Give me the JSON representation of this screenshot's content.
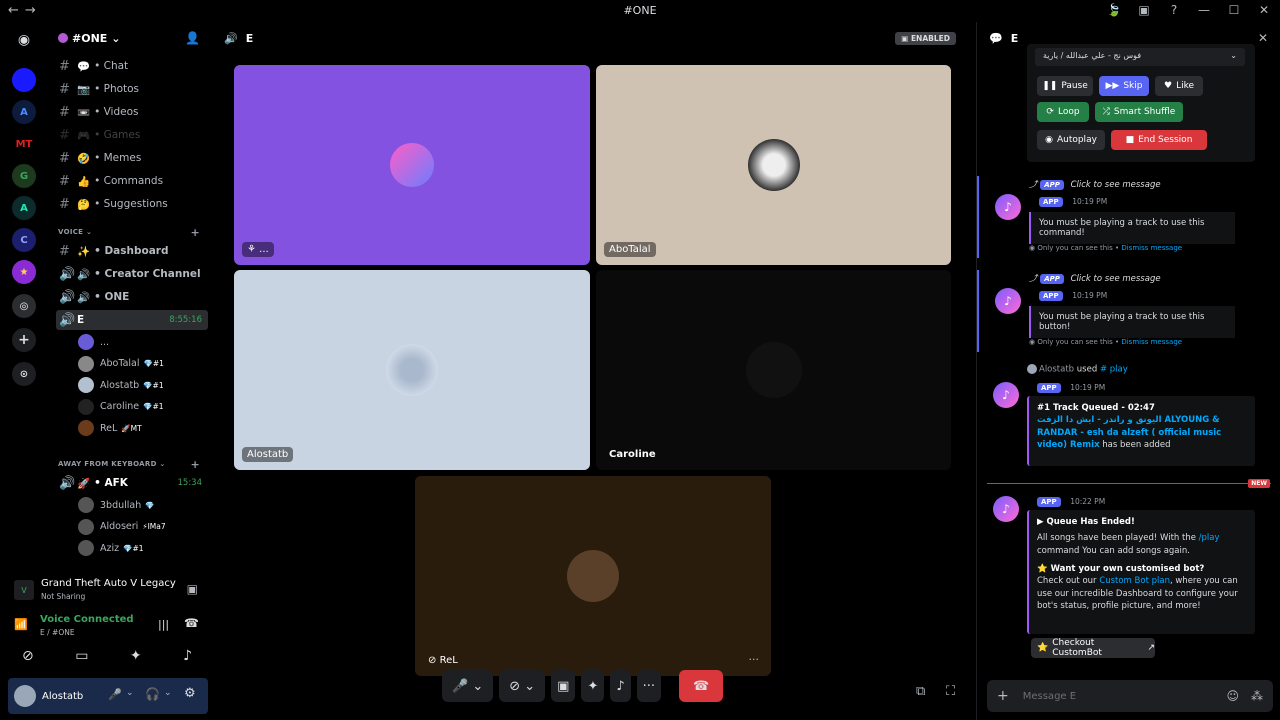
{
  "window": {
    "title": "#ONE"
  },
  "server": {
    "name": "#ONE"
  },
  "text_channels": [
    {
      "label": "• Chat",
      "emoji": "💬"
    },
    {
      "label": "• Photos",
      "emoji": "📷"
    },
    {
      "label": "• Videos",
      "emoji": "📼"
    },
    {
      "label": "• Games",
      "emoji": "🎮"
    },
    {
      "label": "• Memes",
      "emoji": "🤣"
    },
    {
      "label": "• Commands",
      "emoji": "👍"
    },
    {
      "label": "• Suggestions",
      "emoji": "🤔"
    }
  ],
  "voice_category": "VOICE",
  "voice_channels": [
    {
      "label": "• Dashboard",
      "emoji": "✨"
    },
    {
      "label": "• Creator Channel",
      "emoji": "🔊"
    },
    {
      "label": "• ONE",
      "emoji": "🔊"
    },
    {
      "label": "E",
      "timer": "8:55:16"
    }
  ],
  "voice_users": [
    {
      "name": "...",
      "tag": ""
    },
    {
      "name": "AboTalal",
      "tag": "💎#1"
    },
    {
      "name": "Alostatb",
      "tag": "💎#1"
    },
    {
      "name": "Caroline",
      "tag": "💎#1"
    },
    {
      "name": "ReL",
      "tag": "🚀MT"
    }
  ],
  "afk_category": "AWAY FROM KEYBOARD",
  "afk_channel": {
    "label": "• AFK",
    "timer": "15:34"
  },
  "afk_users": [
    {
      "name": "3bdullah",
      "tag": "💎"
    },
    {
      "name": "Aldoseri",
      "tag": "⚡IMa7"
    },
    {
      "name": "Aziz",
      "tag": "💎#1"
    }
  ],
  "activity": {
    "game": "Grand Theft Auto V Legacy",
    "status": "Not Sharing"
  },
  "voice_status": {
    "label": "Voice Connected",
    "channel": "E / #ONE"
  },
  "user": {
    "name": "Alostatb"
  },
  "call": {
    "channel": "E",
    "badge": "ENABLED"
  },
  "tiles": [
    {
      "label": "...",
      "bg": "#8452e0"
    },
    {
      "label": "AboTalal",
      "bg": "#cfc2b2"
    },
    {
      "label": "Alostatb",
      "bg": "#c9d4e2"
    },
    {
      "label": "Caroline",
      "bg": "#0a0a0a"
    },
    {
      "label": "ReL",
      "bg": "#2a1c0d"
    }
  ],
  "chat": {
    "channel": "E",
    "now_playing": "فوس نج - علي عبدالله / يارية",
    "buttons": {
      "pause": "Pause",
      "skip": "Skip",
      "like": "Like",
      "loop": "Loop",
      "smart_shuffle": "Smart Shuffle",
      "autoplay": "Autoplay",
      "end_session": "End Session"
    },
    "app_badge": "APP",
    "click_to_see": "Click to see message",
    "time1": "10:19 PM",
    "msg1": "You must be playing a track to use this command!",
    "only_you": "Only you can see this •",
    "dismiss": "Dismiss message",
    "msg2": "You must be playing a track to use this button!",
    "used_user": "Alostatb",
    "used_text": "used",
    "used_cmd": "# play",
    "queued_title": "#1 Track Queued - 02:47",
    "queued_track": "اليونق و راندر - ايش دا الزفت ALYOUNG & RANDAR - esh da alzeft ( official music video) Remix",
    "queued_suffix": "has been added",
    "new_badge": "NEW",
    "time2": "10:22 PM",
    "ended_title": "Queue Has Ended!",
    "ended_p1": "All songs have been played! With the",
    "ended_cmd": "/play",
    "ended_p2": "command You can add songs again.",
    "custom_title": "Want your own customised bot?",
    "custom_p1": "Check out our",
    "custom_link": "Custom Bot plan",
    "custom_p2": ", where you can use our incredible Dashboard to configure your bot's status, profile picture, and more!",
    "checkout": "Checkout CustomBot",
    "placeholder": "Message E"
  }
}
